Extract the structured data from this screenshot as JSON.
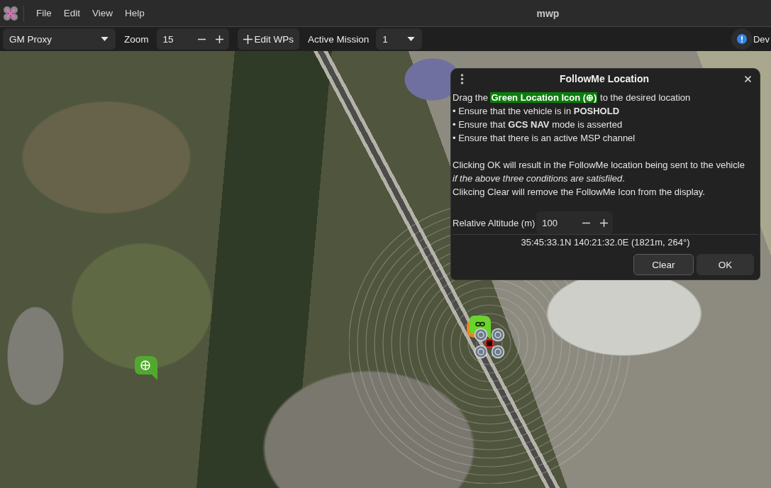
{
  "window": {
    "title": "mwp",
    "menu": [
      "File",
      "Edit",
      "View",
      "Help"
    ]
  },
  "toolbar": {
    "map_source": "GM Proxy",
    "zoom_label": "Zoom",
    "zoom_value": "15",
    "edit_button": "Edit WPs",
    "mission_label": "Active Mission",
    "mission_value": "1",
    "status_text": "Dev"
  },
  "dialog": {
    "title": "FollowMe Location",
    "intro": {
      "before": "Drag the ",
      "highlight": "Green Location Icon (⊕)",
      "after": " to the desired location"
    },
    "bullets": [
      "• Ensure that the vehicle is in **POSHOLD**",
      "• Ensure that **GCS NAV** mode is asserted",
      "• Ensure that there is an active MSP channel"
    ],
    "notes": [
      {
        "lines": [
          "Clicking OK will result in the FollowMe location being sent to the vehicle",
          "*if the above three conditions are satisfiled*."
        ]
      },
      {
        "lines": [
          "Clikcing Clear will remove the FollowMe Icon from the display."
        ]
      }
    ],
    "altitude": {
      "label": "Relative Altitude (m)",
      "value": "100"
    },
    "position": "35:45:33.1N 140:21:32.0E (1821m, 264°)",
    "buttons": [
      {
        "label": "Clear",
        "focused": true
      },
      {
        "label": "OK",
        "focused": false
      }
    ]
  }
}
